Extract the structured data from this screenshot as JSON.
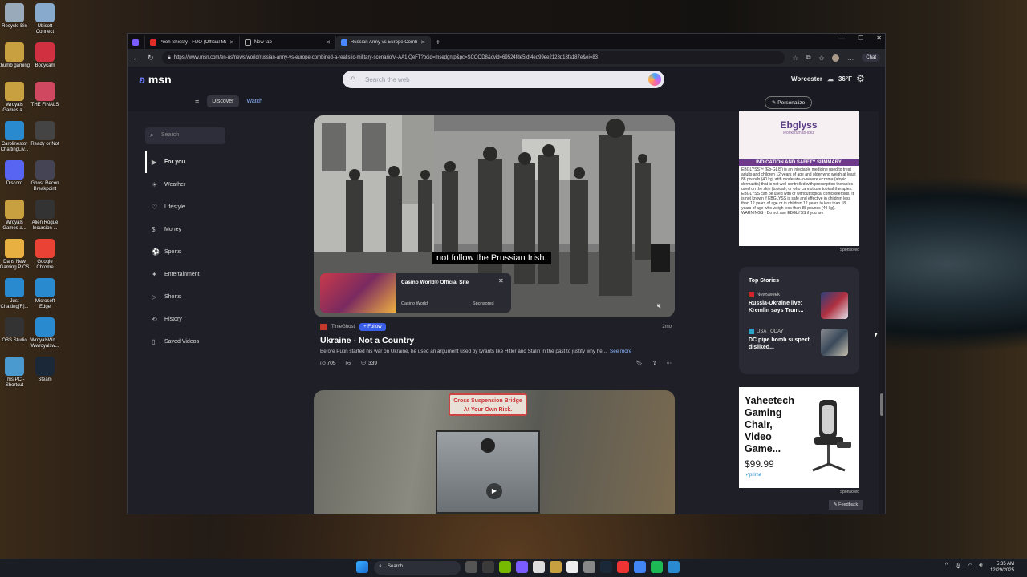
{
  "desktop_icons": [
    {
      "label": "Recycle Bin",
      "x": 0
    },
    {
      "label": "Ubisoft Connect",
      "x": 0
    },
    {
      "label": "thumb gaming",
      "x": 0
    },
    {
      "label": "Bodycam",
      "x": 0
    },
    {
      "label": "Wroyals Games a...",
      "x": 0
    },
    {
      "label": "THE FINALS",
      "x": 0
    },
    {
      "label": "Carolinestor ChattingLiv...",
      "x": 0
    },
    {
      "label": "Ready or Not",
      "x": 0
    },
    {
      "label": "Discord",
      "x": 0
    },
    {
      "label": "Ghost Recon Breakpoint",
      "x": 0
    },
    {
      "label": "Wroyals Games a...",
      "x": 0
    },
    {
      "label": "Alien Rogue Incursion ...",
      "x": 0
    },
    {
      "label": "Dans New Gaming PICS",
      "x": 0
    },
    {
      "label": "Google Chrome",
      "x": 0
    },
    {
      "label": "Just Chatting[R]...",
      "x": 0
    },
    {
      "label": "Microsoft Edge",
      "x": 0
    },
    {
      "label": "OBS Studio",
      "x": 0
    },
    {
      "label": "WroyalsWd... Wwroyalsw...",
      "x": 0
    },
    {
      "label": "This PC - Shortcut",
      "x": 0
    },
    {
      "label": "Steam",
      "x": 0
    }
  ],
  "browser": {
    "tabs": [
      {
        "label": "Pooh Shiesty - FDO (Official Music"
      },
      {
        "label": "New tab"
      },
      {
        "label": "Russian Army vs Europe Combi"
      }
    ],
    "url": "https://www.msn.com/en-us/news/world/russian-army-vs-europe-combined-a-realistic-military-scenario/vi-AA1IQeFT?ocid=msedgntp&pc=SCOOD8&cvid=69524fde5fdf4ed99ee2128d18fa187e&ei=83",
    "chat_label": "Chat"
  },
  "msn": {
    "logo": "msn",
    "search_placeholder": "Search the web",
    "location": "Worcester",
    "temp": "36°F",
    "nav": {
      "discover": "Discover",
      "watch": "Watch"
    },
    "personalize": "Personalize",
    "sidebar": {
      "search_placeholder": "Search",
      "items": [
        {
          "label": "For you"
        },
        {
          "label": "Weather"
        },
        {
          "label": "Lifestyle"
        },
        {
          "label": "Money"
        },
        {
          "label": "Sports"
        },
        {
          "label": "Entertainment"
        },
        {
          "label": "Shorts"
        },
        {
          "label": "History"
        },
        {
          "label": "Saved Videos"
        }
      ]
    },
    "video": {
      "caption": "not follow the Prussian Irish.",
      "ad_title": "Casino World® Official Site",
      "ad_source": "Casino World",
      "ad_sponsored": "Sponsored",
      "publisher": "TimeGhost",
      "follow": "+ Follow",
      "age": "2mo",
      "title": "Ukraine - Not a Country",
      "description": "Before Putin started his war on Ukraine, he used an argument used by tyrants like Hitler and Stalin in the past to justify why he...",
      "see_more": "See more",
      "likes": "705",
      "comments": "339"
    },
    "video2": {
      "sign": "Cross Suspension Bridge At Your Own Risk."
    },
    "ad1": {
      "brand": "Ebglyss",
      "sub": "lebrikizumab-lbkz",
      "bar": "INDICATION AND SAFETY SUMMARY",
      "text": "EBGLYSS™ (Eb-GLIS) is an injectable medicine used to treat adults and children 12 years of age and older who weigh at least 88 pounds (40 kg) with moderate-to-severe eczema (atopic dermatitis) that is not well controlled with prescription therapies used on the skin (topical), or who cannot use topical therapies. EBGLYSS can be used with or without topical corticosteroids. It is not known if EBGLYSS is safe and effective in children less than 12 years of age or in children 12 years to less than 18 years of age who weigh less than 88 pounds (40 kg). WARNINGS - Do not use EBGLYSS if you are",
      "sponsored": "Sponsored"
    },
    "top_stories": {
      "heading": "Top Stories",
      "items": [
        {
          "publisher": "Newsweek",
          "headline": "Russia-Ukraine live: Kremlin says Trum...",
          "color": "#d0252d"
        },
        {
          "publisher": "USA TODAY",
          "headline": "DC pipe bomb suspect disliked...",
          "color": "#2aa3c7"
        }
      ]
    },
    "ad2": {
      "title": "Yaheetech Gaming Chair, Video Game...",
      "price": "$99.99",
      "prime": "✓prime",
      "sponsored": "Sponsored"
    },
    "feedback": "Feedback"
  },
  "taskbar": {
    "search": "Search",
    "time": "5:35 AM",
    "date": "12/29/2025"
  }
}
